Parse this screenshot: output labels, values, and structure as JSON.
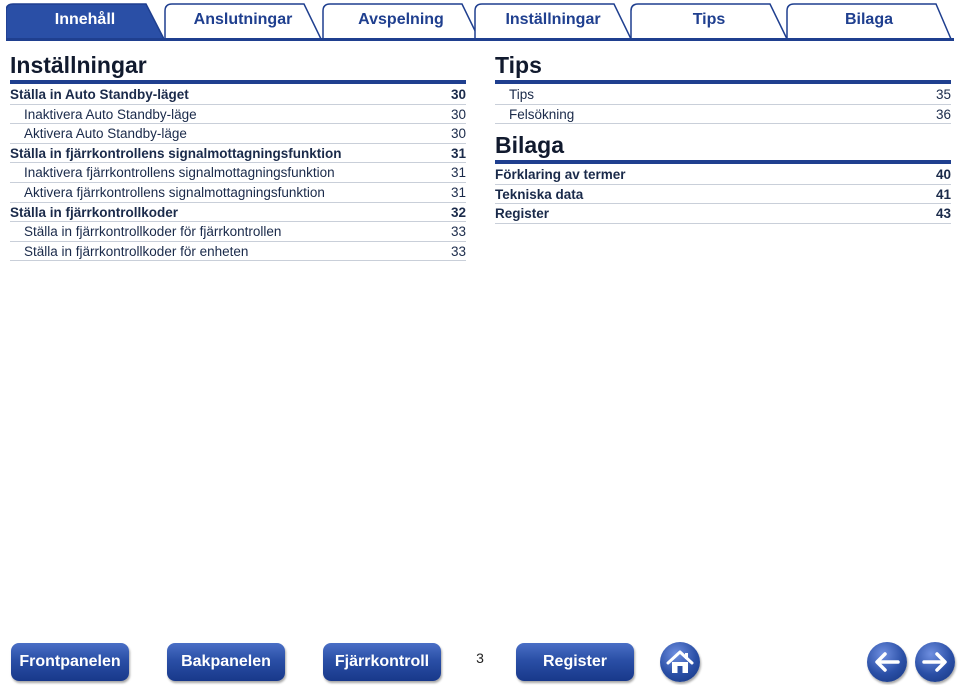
{
  "tabs": [
    {
      "label": "Innehåll",
      "active": true
    },
    {
      "label": "Anslutningar",
      "active": false
    },
    {
      "label": "Avspelning",
      "active": false
    },
    {
      "label": "Inställningar",
      "active": false
    },
    {
      "label": "Tips",
      "active": false
    },
    {
      "label": "Bilaga",
      "active": false
    }
  ],
  "left": {
    "title": "Inställningar",
    "rows": [
      {
        "text": "Ställa in Auto Standby-läget",
        "page": "30",
        "level": 1
      },
      {
        "text": "Inaktivera Auto Standby-läge",
        "page": "30",
        "level": 2
      },
      {
        "text": "Aktivera Auto Standby-läge",
        "page": "30",
        "level": 2
      },
      {
        "text": "Ställa in fjärrkontrollens signalmottagningsfunktion",
        "page": "31",
        "level": 1
      },
      {
        "text": "Inaktivera fjärrkontrollens signalmottagningsfunktion",
        "page": "31",
        "level": 2
      },
      {
        "text": "Aktivera fjärrkontrollens signalmottagningsfunktion",
        "page": "31",
        "level": 2
      },
      {
        "text": "Ställa in fjärrkontrollkoder",
        "page": "32",
        "level": 1
      },
      {
        "text": "Ställa in fjärrkontrollkoder för fjärrkontrollen",
        "page": "33",
        "level": 2
      },
      {
        "text": "Ställa in fjärrkontrollkoder för enheten",
        "page": "33",
        "level": 2
      }
    ]
  },
  "right": {
    "tips_title": "Tips",
    "tips_rows": [
      {
        "text": "Tips",
        "page": "35"
      },
      {
        "text": "Felsökning",
        "page": "36"
      }
    ],
    "bilaga_title": "Bilaga",
    "bilaga_rows": [
      {
        "text": "Förklaring av termer",
        "page": "40"
      },
      {
        "text": "Tekniska data",
        "page": "41"
      },
      {
        "text": "Register",
        "page": "43"
      }
    ]
  },
  "bottom": {
    "front_label": "Frontpanelen",
    "back_label": "Bakpanelen",
    "remote_label": "Fjärrkontroll",
    "page_number": "3",
    "register_label": "Register",
    "home_icon": "home-icon",
    "prev_icon": "arrow-left-icon",
    "next_icon": "arrow-right-icon"
  },
  "colors": {
    "accent": "#1f3f8f",
    "button": "#2a4fa6"
  }
}
